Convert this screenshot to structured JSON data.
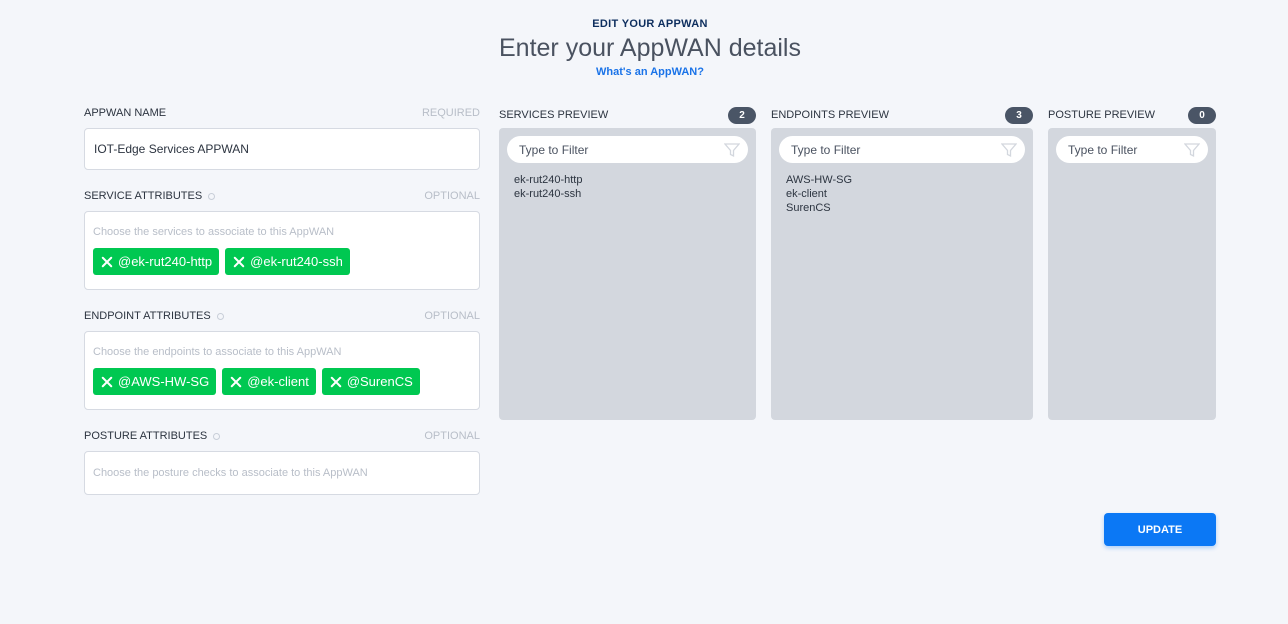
{
  "header": {
    "eyebrow": "EDIT YOUR APPWAN",
    "title": "Enter your AppWAN details",
    "help_link": "What's an AppWAN?"
  },
  "form": {
    "name": {
      "label": "APPWAN NAME",
      "hint": "REQUIRED",
      "value": "IOT-Edge Services APPWAN"
    },
    "services": {
      "label": "SERVICE ATTRIBUTES",
      "hint": "OPTIONAL",
      "placeholder": "Choose the services to associate to this AppWAN",
      "chips": [
        "@ek-rut240-http",
        "@ek-rut240-ssh"
      ]
    },
    "endpoints": {
      "label": "ENDPOINT ATTRIBUTES",
      "hint": "OPTIONAL",
      "placeholder": "Choose the endpoints to associate to this AppWAN",
      "chips": [
        "@AWS-HW-SG",
        "@ek-client",
        "@SurenCS"
      ]
    },
    "posture": {
      "label": "POSTURE ATTRIBUTES",
      "hint": "OPTIONAL",
      "placeholder": "Choose the posture checks to associate to this AppWAN"
    }
  },
  "previews": {
    "services": {
      "title": "SERVICES PREVIEW",
      "count": "2",
      "filter": "Type to Filter",
      "items": [
        "ek-rut240-http",
        "ek-rut240-ssh"
      ]
    },
    "endpoints": {
      "title": "ENDPOINTS PREVIEW",
      "count": "3",
      "filter": "Type to Filter",
      "items": [
        "AWS-HW-SG",
        "ek-client",
        "SurenCS"
      ]
    },
    "posture": {
      "title": "POSTURE PREVIEW",
      "count": "0",
      "filter": "Type to Filter",
      "items": []
    }
  },
  "actions": {
    "update": "UPDATE"
  },
  "colors": {
    "accent": "#0b78f5",
    "chip": "#00c851",
    "panel": "#d3d7de"
  }
}
